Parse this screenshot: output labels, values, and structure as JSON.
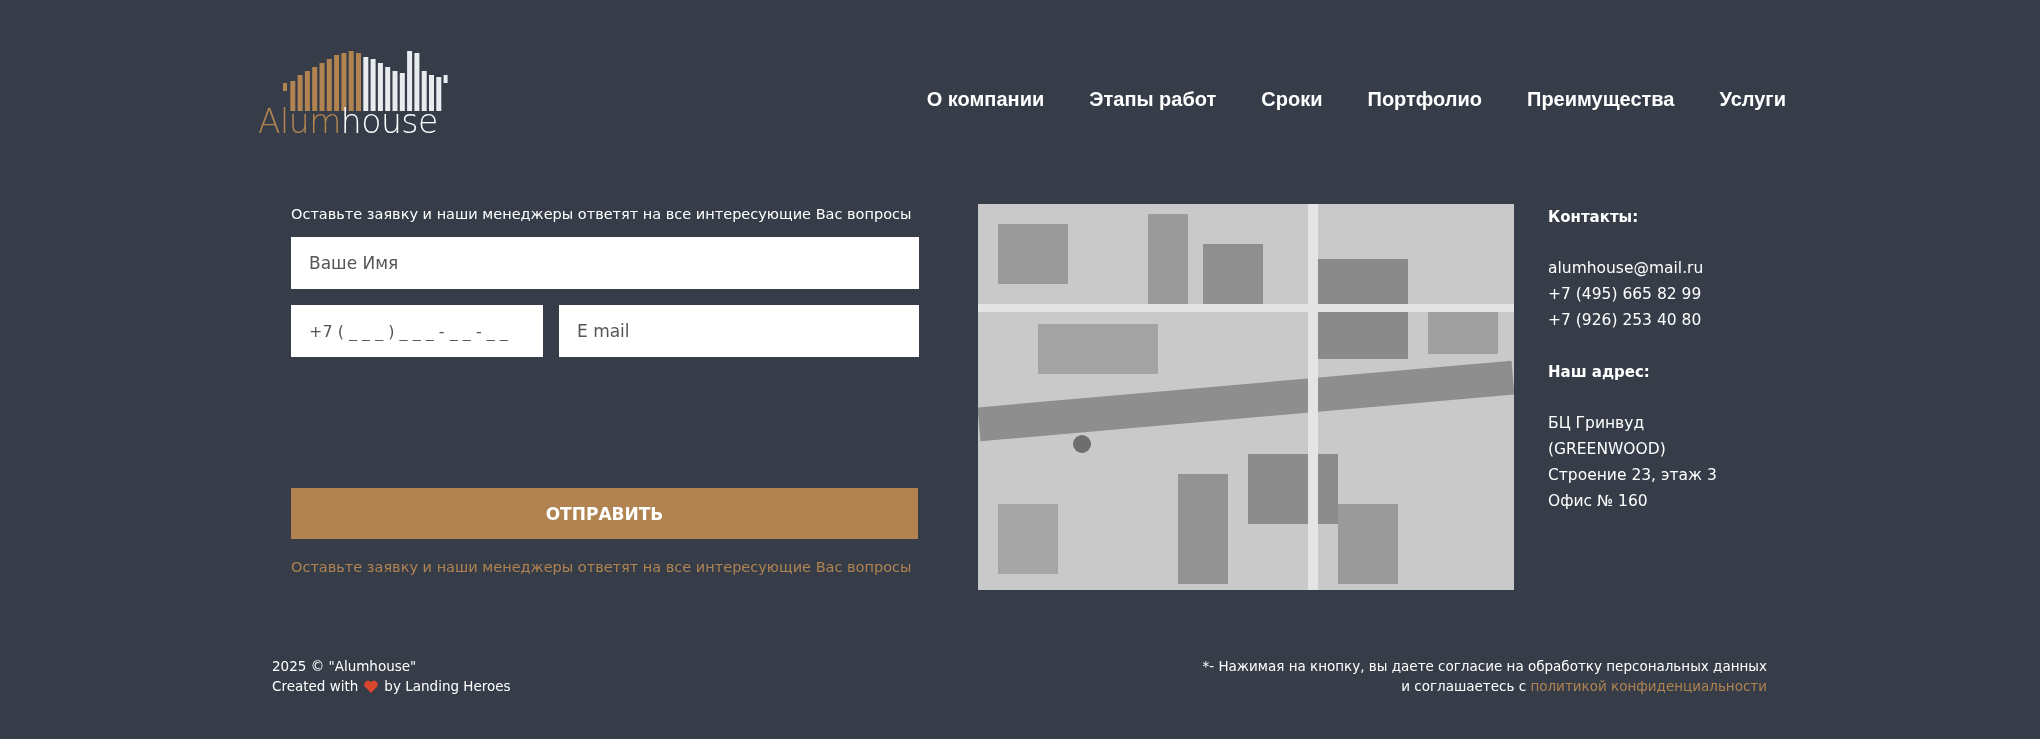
{
  "logo": {
    "part_1": "Alum",
    "part_2": "house"
  },
  "nav": [
    {
      "label": "О компании"
    },
    {
      "label": "Этапы работ"
    },
    {
      "label": "Сроки"
    },
    {
      "label": "Портфолио"
    },
    {
      "label": "Преимущества"
    },
    {
      "label": "Услуги"
    }
  ],
  "form": {
    "intro": "Оставьте заявку и наши менеджеры ответят на все интересующие Вас вопросы",
    "name_field": {
      "placeholder": "Ваше Имя"
    },
    "phone_field": {
      "placeholder": "+7 ( _ _ _ ) _ _ _ - _ _ - _ _"
    },
    "email_field": {
      "placeholder": "E mail"
    },
    "submit": "ОТПРАВИТЬ",
    "note": "Оставьте заявку и наши менеджеры ответят на все интересующие Вас вопросы"
  },
  "contacts": {
    "heading": "Контакты:",
    "lines": [
      "alumhouse@mail.ru",
      "+7 (495) 665 82 99",
      "+7 (926) 253 40 80"
    ],
    "address_heading": "Наш адрес:",
    "address_lines": [
      "БЦ Гринвуд",
      "(GREENWOOD)",
      "Строение 23, этаж 3",
      "Офис № 160"
    ]
  },
  "footer": {
    "copyright": "2025 © \"Alumhouse\"",
    "credit_before": "Created with",
    "credit_after": "by Landing Heroes",
    "consent": "*- Нажимая на кнопку, вы даете согласие на обработку персональных данных",
    "consent_before": "и соглашаетесь с",
    "policy_link": "политикой конфиденциальности"
  }
}
